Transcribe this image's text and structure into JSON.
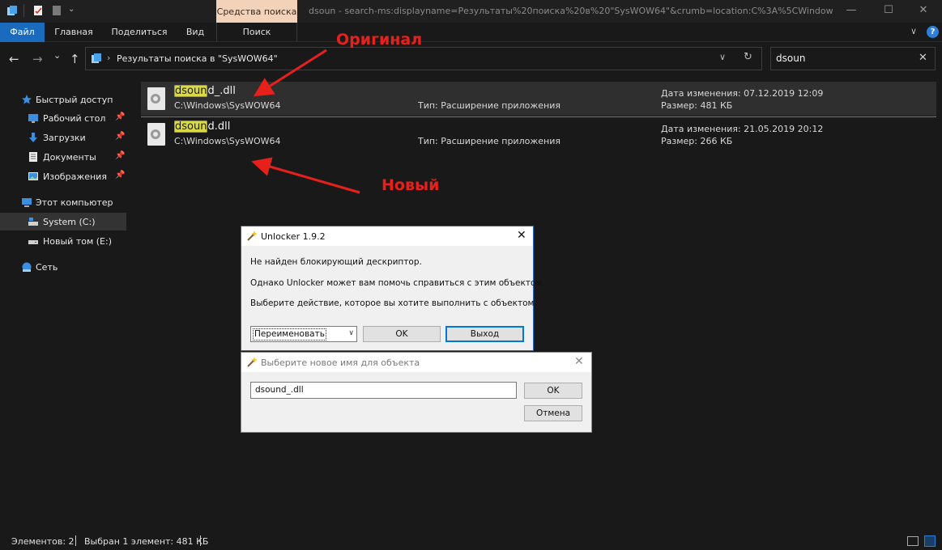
{
  "window": {
    "title": "dsoun - search-ms:displayname=Результаты%20поиска%20в%20\"SysWOW64\"&crumb=location:C%3A%5CWindow",
    "context_tab_group": "Средства поиска",
    "minimize": "—",
    "maximize": "☐",
    "close": "✕"
  },
  "ribbon": {
    "tabs": [
      "Файл",
      "Главная",
      "Поделиться",
      "Вид",
      "Поиск"
    ],
    "chevron": "∨",
    "help": "?"
  },
  "nav": {
    "back": "←",
    "forward": "→",
    "recent": "⌄",
    "up": "↑",
    "breadcrumb_sep": "›",
    "address": "Результаты поиска в \"SysWOW64\"",
    "address_dropdown": "∨",
    "refresh": "↻",
    "search_value": "dsoun",
    "search_clear": "✕"
  },
  "sidebar": {
    "pin": "📌",
    "items": [
      {
        "label": "Быстрый доступ",
        "icon": "star-icon",
        "pinned": false
      },
      {
        "label": "Рабочий стол",
        "icon": "desktop-icon",
        "pinned": true
      },
      {
        "label": "Загрузки",
        "icon": "download-icon",
        "pinned": true
      },
      {
        "label": "Документы",
        "icon": "document-icon",
        "pinned": true
      },
      {
        "label": "Изображения",
        "icon": "image-icon",
        "pinned": true
      },
      {
        "label": "Этот компьютер",
        "icon": "computer-icon",
        "pinned": false
      },
      {
        "label": "System (C:)",
        "icon": "drive-icon",
        "pinned": false,
        "selected": true
      },
      {
        "label": "Новый том (E:)",
        "icon": "drive-icon",
        "pinned": false
      },
      {
        "label": "Сеть",
        "icon": "network-icon",
        "pinned": false
      }
    ]
  },
  "results": [
    {
      "name_match": "dsoun",
      "name_rest": "d_.dll",
      "path": "C:\\Windows\\SysWOW64",
      "type": "Тип: Расширение приложения",
      "date": "Дата изменения: 07.12.2019 12:09",
      "size": "Размер: 481 КБ",
      "selected": true
    },
    {
      "name_match": "dsoun",
      "name_rest": "d.dll",
      "path": "C:\\Windows\\SysWOW64",
      "type": "Тип: Расширение приложения",
      "date": "Дата изменения: 21.05.2019 20:12",
      "size": "Размер: 266 КБ",
      "selected": false
    }
  ],
  "annotations": {
    "original": "Оригинал",
    "new": "Новый",
    "color": "#e8201c"
  },
  "status": {
    "count": "Элементов: 2",
    "selection": "Выбран 1 элемент: 481 КБ"
  },
  "dialog_unlocker": {
    "title": "Unlocker 1.9.2",
    "close": "✕",
    "line1": "Не найден блокирующий дескриптор.",
    "line2": "Однако Unlocker может вам помочь справиться с этим объектом.",
    "line3": "Выберите действие, которое вы хотите выполнить с объектом.",
    "action_selected": "Переименовать",
    "select_arrow": "∨",
    "ok": "OK",
    "exit": "Выход"
  },
  "dialog_rename": {
    "title": "Выберите новое имя для объекта",
    "close": "✕",
    "value": "dsound_.dll",
    "ok": "OK",
    "cancel": "Отмена"
  },
  "colors": {
    "accent": "#1a6bbd",
    "highlight": "#d9d94a",
    "context_tab": "#f2d3b9"
  }
}
